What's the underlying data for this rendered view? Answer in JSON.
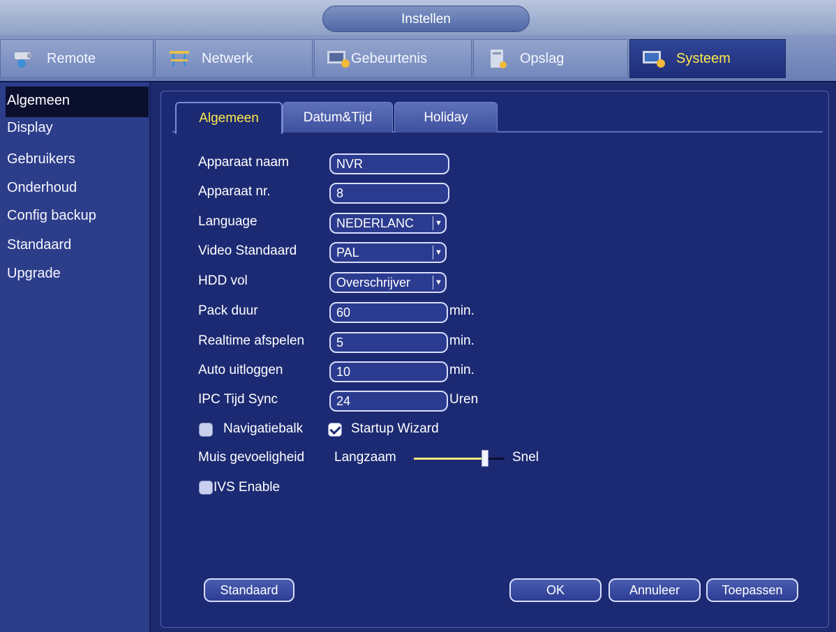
{
  "window": {
    "title": "Instellen"
  },
  "main_tabs": [
    {
      "label": "Remote",
      "icon": "camera-icon"
    },
    {
      "label": "Netwerk",
      "icon": "network-icon"
    },
    {
      "label": "Gebeurtenis",
      "icon": "event-icon"
    },
    {
      "label": "Opslag",
      "icon": "storage-icon"
    },
    {
      "label": "Systeem",
      "icon": "system-icon",
      "active": true
    }
  ],
  "sidebar": {
    "items": [
      {
        "label": "Algemeen",
        "active": true
      },
      {
        "label": "Display"
      },
      {
        "label": "Gebruikers"
      },
      {
        "label": "Onderhoud"
      },
      {
        "label": "Config backup"
      },
      {
        "label": "Standaard"
      },
      {
        "label": "Upgrade"
      }
    ]
  },
  "sub_tabs": [
    {
      "label": "Algemeen",
      "active": true
    },
    {
      "label": "Datum&Tijd"
    },
    {
      "label": "Holiday"
    }
  ],
  "form": {
    "device_name": {
      "label": "Apparaat naam",
      "value": "NVR"
    },
    "device_no": {
      "label": "Apparaat nr.",
      "value": "8"
    },
    "language": {
      "label": "Language",
      "value": "NEDERLANC"
    },
    "video_standard": {
      "label": "Video Standaard",
      "value": "PAL"
    },
    "hdd_full": {
      "label": "HDD vol",
      "value": "Overschrijver"
    },
    "pack_duration": {
      "label": "Pack duur",
      "value": "60",
      "unit": "min."
    },
    "realtime_playback": {
      "label": "Realtime afspelen",
      "value": "5",
      "unit": "min."
    },
    "auto_logout": {
      "label": "Auto uitloggen",
      "value": "10",
      "unit": "min."
    },
    "ipc_time_sync": {
      "label": "IPC Tijd Sync",
      "value": "24",
      "unit": "Uren"
    },
    "navbar": {
      "label": "Navigatiebalk",
      "checked": false
    },
    "startup_wizard": {
      "label": "Startup Wizard",
      "checked": true
    },
    "mouse_sensitivity": {
      "label": "Muis gevoeligheid",
      "min_label": "Langzaam",
      "max_label": "Snel",
      "level": 0.78
    },
    "ivs_enable": {
      "label": "IVS Enable",
      "checked": false
    }
  },
  "buttons": {
    "default_label": "Standaard",
    "ok_label": "OK",
    "cancel_label": "Annuleer",
    "apply_label": "Toepassen"
  },
  "colors": {
    "active_text": "#ffe94b",
    "background": "#1d2a6e"
  }
}
